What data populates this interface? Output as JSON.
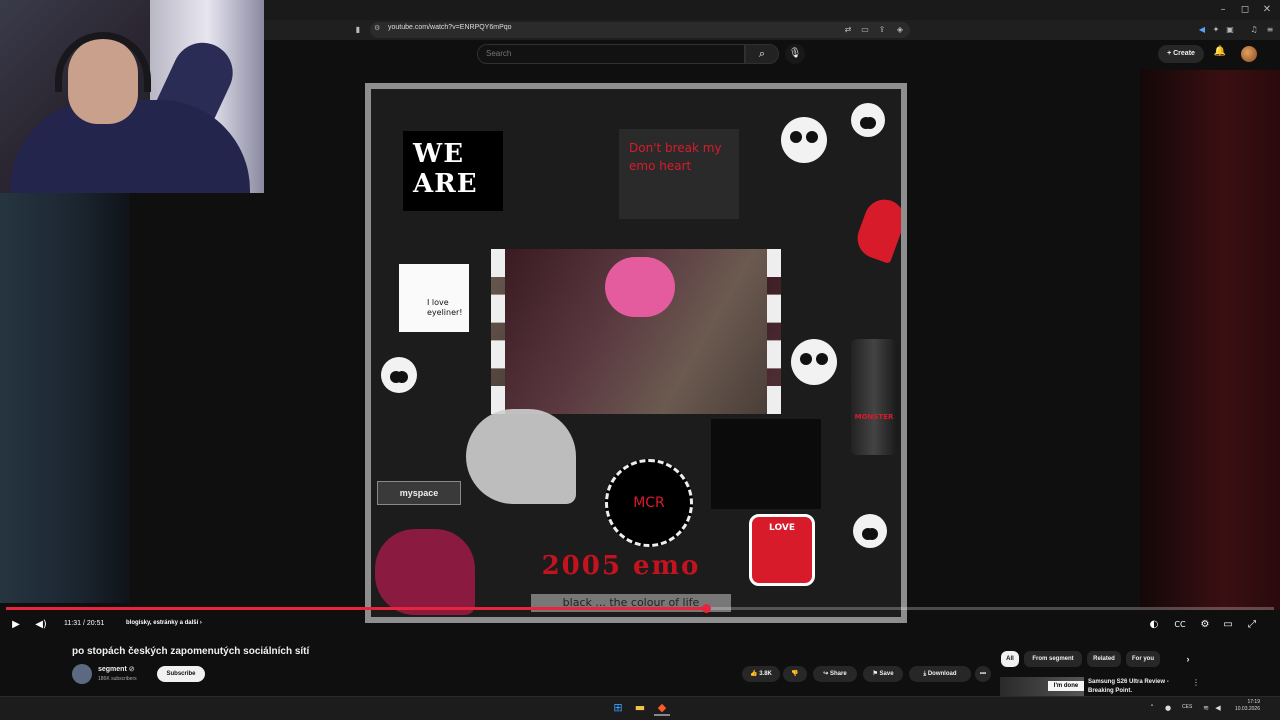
{
  "browser": {
    "url": "youtube.com/watch?v=ENRPQY6mPqo"
  },
  "youtube": {
    "search_placeholder": "Search",
    "create_label": "Create"
  },
  "collage": {
    "we_are": "WE ARE",
    "heart_note": "Don't break my emo heart",
    "eyeliner": "I love eyeliner!",
    "myspace": "myspace",
    "mcr": "MCR",
    "emo_2005": "2005 emo",
    "black_colour": "black ... the colour of life",
    "monster": "MONSTER",
    "love": "LOVE"
  },
  "player": {
    "time": "11:31 / 20:51",
    "chapter": "blogísky, estránky a další",
    "progress_fraction": 0.552,
    "progress_color": "#e8253c"
  },
  "video": {
    "title": "po stopách českých zapomenutých sociálních sítí",
    "channel": "segment",
    "verified_mark": "⊘",
    "subscribers": "186K subscribers",
    "subscribe_label": "Subscribe",
    "likes": "3.8K",
    "share_label": "Share",
    "save_label": "Save",
    "download_label": "Download",
    "more_label": "•••"
  },
  "chips": [
    "All",
    "From segment",
    "Related",
    "For you"
  ],
  "recommendation": {
    "tag": "I'm done",
    "title": "Samsung S26 Ultra Review - Breaking Point."
  },
  "taskbar": {
    "lang": "CES",
    "time": "17:19",
    "date": "10.03.2026"
  }
}
